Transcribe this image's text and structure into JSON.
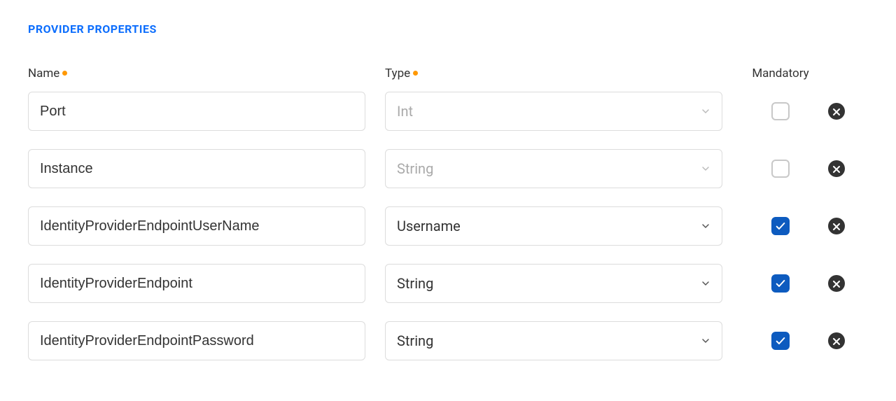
{
  "section": {
    "title": "PROVIDER PROPERTIES"
  },
  "columns": {
    "name": "Name",
    "type": "Type",
    "mandatory": "Mandatory"
  },
  "rows": [
    {
      "name": "Port",
      "type": "Int",
      "type_is_placeholder": true,
      "mandatory": false
    },
    {
      "name": "Instance",
      "type": "String",
      "type_is_placeholder": true,
      "mandatory": false
    },
    {
      "name": "IdentityProviderEndpointUserName",
      "type": "Username",
      "type_is_placeholder": false,
      "mandatory": true
    },
    {
      "name": "IdentityProviderEndpoint",
      "type": "String",
      "type_is_placeholder": false,
      "mandatory": true
    },
    {
      "name": "IdentityProviderEndpointPassword",
      "type": "String",
      "type_is_placeholder": false,
      "mandatory": true
    }
  ]
}
